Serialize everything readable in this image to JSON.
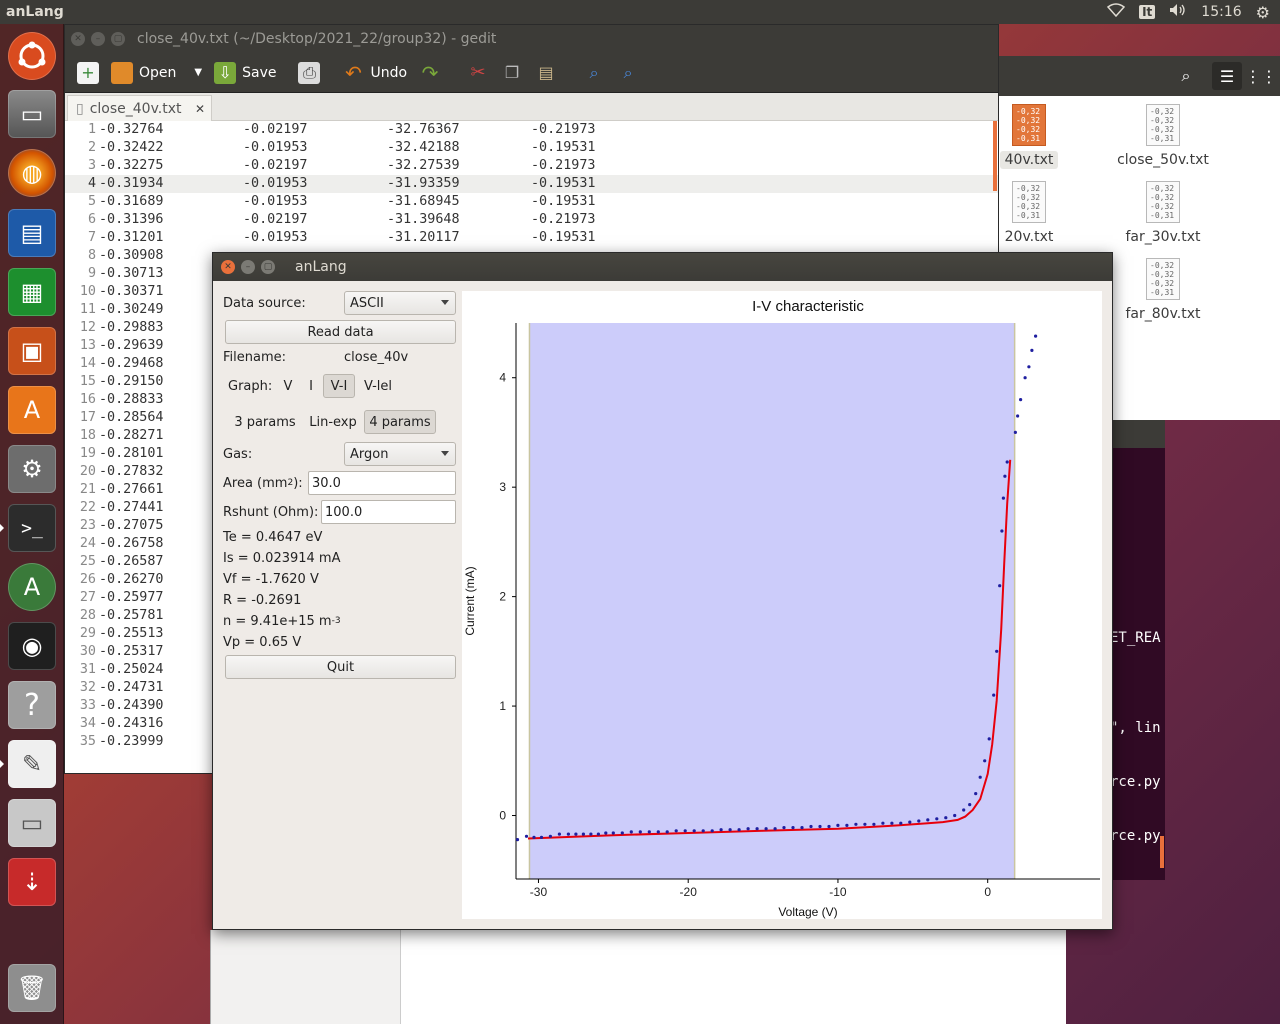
{
  "top_panel": {
    "app_name": "anLang",
    "keyboard": "It",
    "clock": "15:16"
  },
  "launcher": {
    "items": [
      "ubuntu-dash",
      "files",
      "firefox",
      "writer",
      "calc",
      "impress",
      "software-center",
      "system-settings",
      "terminal",
      "software-updater",
      "camera",
      "help",
      "text-editor",
      "disk",
      "usb"
    ],
    "trash": "trash"
  },
  "gedit": {
    "title": "close_40v.txt (~/Desktop/2021_22/group32) - gedit",
    "toolbar": {
      "open": "Open",
      "save": "Save",
      "undo": "Undo"
    },
    "tab": {
      "label": "close_40v.txt"
    },
    "current_line": 4,
    "lines": [
      [
        "1",
        "-0.32764",
        "-0.02197",
        "-32.76367",
        "-0.21973"
      ],
      [
        "2",
        "-0.32422",
        "-0.01953",
        "-32.42188",
        "-0.19531"
      ],
      [
        "3",
        "-0.32275",
        "-0.02197",
        "-32.27539",
        "-0.21973"
      ],
      [
        "4",
        "-0.31934",
        "-0.01953",
        "-31.93359",
        "-0.19531"
      ],
      [
        "5",
        "-0.31689",
        "-0.01953",
        "-31.68945",
        "-0.19531"
      ],
      [
        "6",
        "-0.31396",
        "-0.02197",
        "-31.39648",
        "-0.21973"
      ],
      [
        "7",
        "-0.31201",
        "-0.01953",
        "-31.20117",
        "-0.19531"
      ],
      [
        "8",
        "-0.30908",
        "",
        "",
        ""
      ],
      [
        "9",
        "-0.30713",
        "",
        "",
        ""
      ],
      [
        "10",
        "-0.30371",
        "",
        "",
        ""
      ],
      [
        "11",
        "-0.30249",
        "",
        "",
        ""
      ],
      [
        "12",
        "-0.29883",
        "",
        "",
        ""
      ],
      [
        "13",
        "-0.29639",
        "",
        "",
        ""
      ],
      [
        "14",
        "-0.29468",
        "",
        "",
        ""
      ],
      [
        "15",
        "-0.29150",
        "",
        "",
        ""
      ],
      [
        "16",
        "-0.28833",
        "",
        "",
        ""
      ],
      [
        "17",
        "-0.28564",
        "",
        "",
        ""
      ],
      [
        "18",
        "-0.28271",
        "",
        "",
        ""
      ],
      [
        "19",
        "-0.28101",
        "",
        "",
        ""
      ],
      [
        "20",
        "-0.27832",
        "",
        "",
        ""
      ],
      [
        "21",
        "-0.27661",
        "",
        "",
        ""
      ],
      [
        "22",
        "-0.27441",
        "",
        "",
        ""
      ],
      [
        "23",
        "-0.27075",
        "",
        "",
        ""
      ],
      [
        "24",
        "-0.26758",
        "",
        "",
        ""
      ],
      [
        "25",
        "-0.26587",
        "",
        "",
        ""
      ],
      [
        "26",
        "-0.26270",
        "",
        "",
        ""
      ],
      [
        "27",
        "-0.25977",
        "",
        "",
        ""
      ],
      [
        "28",
        "-0.25781",
        "",
        "",
        ""
      ],
      [
        "29",
        "-0.25513",
        "",
        "",
        ""
      ],
      [
        "30",
        "-0.25317",
        "",
        "",
        ""
      ],
      [
        "31",
        "-0.25024",
        "",
        "",
        ""
      ],
      [
        "32",
        "-0.24731",
        "",
        "",
        ""
      ],
      [
        "33",
        "-0.24390",
        "",
        "",
        ""
      ],
      [
        "34",
        "-0.24316",
        "",
        "",
        ""
      ],
      [
        "35",
        "-0.23999",
        "",
        "",
        ""
      ]
    ]
  },
  "files": {
    "items": [
      {
        "label": "40v.txt",
        "selected": true
      },
      {
        "label": "close_50v.txt",
        "selected": false
      },
      {
        "label": "20v.txt",
        "selected": false
      },
      {
        "label": "far_30v.txt",
        "selected": false
      },
      {
        "label": "far_80v.txt",
        "selected": false
      }
    ],
    "thumb_text": "-0,32\n-0,32\n-0,32\n-0,31"
  },
  "terminal": {
    "lines": [
      "ET_REA",
      "\", lin",
      "rce.py",
      "rce.py"
    ]
  },
  "anlang": {
    "title": "anLang",
    "data_source_label": "Data source:",
    "data_source_value": "ASCII",
    "read_data": "Read data",
    "filename_label": "Filename:",
    "filename_value": "close_40v",
    "graph_label": "Graph:",
    "graph_options": [
      "V",
      "I",
      "V-I",
      "V-lel"
    ],
    "graph_selected": "V-I",
    "param_options": [
      "3 params",
      "Lin-exp",
      "4 params"
    ],
    "param_selected": "4 params",
    "gas_label": "Gas:",
    "gas_value": "Argon",
    "area_label_pre": "Area (mm",
    "area_label_sup": "2",
    "area_label_post": "):",
    "area_value": "30.0",
    "rshunt_label": "Rshunt (Ohm):",
    "rshunt_value": "100.0",
    "te": "Te = 0.4647 eV",
    "is": "Is = 0.023914 mA",
    "vf": "Vf = -1.7620 V",
    "r": "R = -0.2691",
    "n_pre": "n = 9.41e+15 m",
    "n_sup": "-3",
    "vp": "Vp = 0.65 V",
    "quit": "Quit"
  },
  "colors": {
    "fit_line": "#e8000b",
    "points": "#1f1fa0",
    "shade": "#ccccfa",
    "accent": "#e9703b"
  },
  "chart_data": {
    "type": "scatter",
    "title": "I-V characteristic",
    "xlabel": "Voltage (V)",
    "ylabel": "Current (mA)",
    "xlim": [
      -31.5,
      7.5
    ],
    "ylim": [
      -0.58,
      4.5
    ],
    "xticks": [
      -30,
      -20,
      -10,
      0
    ],
    "yticks": [
      0,
      1,
      2,
      3,
      4
    ],
    "shaded_range_x": [
      -30.6,
      1.8
    ],
    "series": [
      {
        "kind": "points",
        "x": [
          -31.4,
          -30.8,
          -30.3,
          -29.8,
          -29.2,
          -28.6,
          -28.0,
          -27.5,
          -27.0,
          -26.5,
          -26.0,
          -25.5,
          -25.0,
          -24.4,
          -23.8,
          -23.2,
          -22.6,
          -22.0,
          -21.4,
          -20.8,
          -20.2,
          -19.6,
          -19.0,
          -18.4,
          -17.8,
          -17.2,
          -16.6,
          -16.0,
          -15.4,
          -14.8,
          -14.2,
          -13.6,
          -13.0,
          -12.4,
          -11.8,
          -11.2,
          -10.6,
          -10.0,
          -9.4,
          -8.8,
          -8.2,
          -7.6,
          -7.0,
          -6.4,
          -5.8,
          -5.2,
          -4.6,
          -4.0,
          -3.4,
          -2.8,
          -2.2,
          -1.6,
          -1.2,
          -0.8,
          -0.5,
          -0.2,
          0.1,
          0.4,
          0.6,
          0.8,
          0.95,
          1.05,
          1.15,
          1.3,
          1.85,
          2.0,
          2.2,
          2.5,
          2.75,
          2.95,
          3.2
        ],
        "y": [
          -0.22,
          -0.19,
          -0.2,
          -0.2,
          -0.19,
          -0.17,
          -0.17,
          -0.17,
          -0.17,
          -0.17,
          -0.17,
          -0.16,
          -0.16,
          -0.16,
          -0.15,
          -0.15,
          -0.15,
          -0.15,
          -0.15,
          -0.14,
          -0.14,
          -0.14,
          -0.14,
          -0.14,
          -0.13,
          -0.13,
          -0.13,
          -0.12,
          -0.12,
          -0.12,
          -0.12,
          -0.11,
          -0.11,
          -0.11,
          -0.1,
          -0.1,
          -0.1,
          -0.09,
          -0.09,
          -0.08,
          -0.08,
          -0.08,
          -0.07,
          -0.07,
          -0.07,
          -0.06,
          -0.05,
          -0.04,
          -0.03,
          -0.02,
          0.0,
          0.05,
          0.1,
          0.2,
          0.35,
          0.5,
          0.7,
          1.1,
          1.5,
          2.1,
          2.6,
          2.9,
          3.1,
          3.23,
          3.5,
          3.65,
          3.8,
          4.0,
          4.1,
          4.25,
          4.38
        ]
      },
      {
        "kind": "fit",
        "x": [
          -30.7,
          -25,
          -20,
          -15,
          -10,
          -6,
          -4,
          -3,
          -2,
          -1.5,
          -1,
          -0.5,
          0,
          0.3,
          0.6,
          0.9,
          1.1,
          1.3,
          1.5
        ],
        "y": [
          -0.21,
          -0.18,
          -0.16,
          -0.14,
          -0.12,
          -0.09,
          -0.07,
          -0.06,
          -0.04,
          -0.01,
          0.05,
          0.15,
          0.38,
          0.65,
          1.05,
          1.7,
          2.3,
          2.85,
          3.25
        ]
      }
    ]
  }
}
